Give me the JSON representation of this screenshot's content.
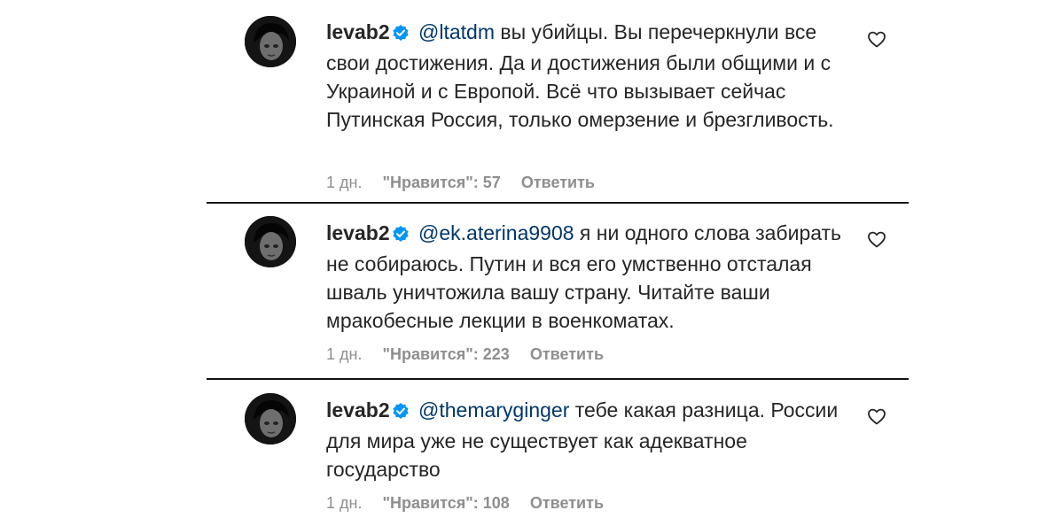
{
  "comments": [
    {
      "username": "levab2",
      "mention": "@ltatdm",
      "text": "вы убийцы. Вы перечеркнули все свои достижения. Да и достижения были общими и с Украиной и с Европой. Всё что вызывает сейчас Путинская Россия, только омерзение и брезгливость.",
      "time": "1 дн.",
      "likes": "\"Нравится\": 57",
      "reply": "Ответить"
    },
    {
      "username": "levab2",
      "mention": "@ek.aterina9908",
      "text": "я ни одного слова забирать не собираюсь. Путин и вся его умственно отсталая шваль уничтожила вашу страну. Читайте ваши мракобесные лекции в военкоматах.",
      "time": "1 дн.",
      "likes": "\"Нравится\": 223",
      "reply": "Ответить"
    },
    {
      "username": "levab2",
      "mention": "@themaryginger",
      "text": "тебе какая разница. России для мира уже не существует как адекватное государство",
      "time": "1 дн.",
      "likes": "\"Нравится\": 108",
      "reply": "Ответить"
    }
  ],
  "colors": {
    "text": "#262626",
    "mention": "#00376b",
    "meta": "#8e8e8e",
    "verified": "#0095f6"
  }
}
